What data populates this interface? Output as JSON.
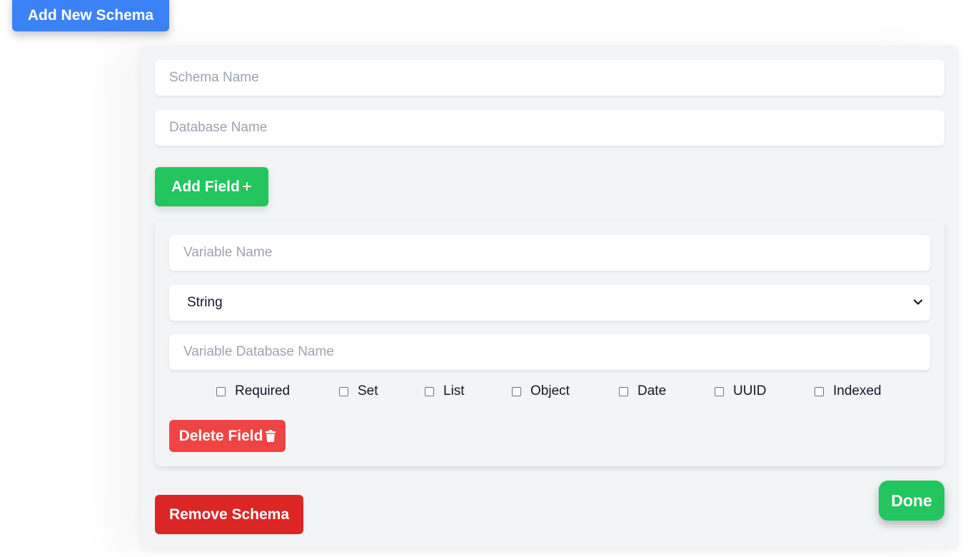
{
  "header": {
    "add_schema_label": "Add New Schema"
  },
  "schema_form": {
    "schema_name": {
      "value": "",
      "placeholder": "Schema Name"
    },
    "database_name": {
      "value": "",
      "placeholder": "Database Name"
    },
    "add_field_label": "Add Field",
    "add_field_icon": "plus-icon",
    "field": {
      "variable_name": {
        "value": "",
        "placeholder": "Variable Name"
      },
      "type_selected": "String",
      "variable_db_name": {
        "value": "",
        "placeholder": "Variable Database Name"
      },
      "options": [
        {
          "label": "Required",
          "checked": false
        },
        {
          "label": "Set",
          "checked": false
        },
        {
          "label": "List",
          "checked": false
        },
        {
          "label": "Object",
          "checked": false
        },
        {
          "label": "Date",
          "checked": false
        },
        {
          "label": "UUID",
          "checked": false
        },
        {
          "label": "Indexed",
          "checked": false
        }
      ],
      "delete_field_label": "Delete Field",
      "delete_field_icon": "trash-icon"
    },
    "remove_schema_label": "Remove Schema",
    "done_label": "Done"
  },
  "colors": {
    "primary_blue": "#3b82f6",
    "success_green": "#22c55e",
    "danger_red": "#ef4444",
    "danger_dark_red": "#dc2626",
    "card_background": "#f3f4f6"
  }
}
